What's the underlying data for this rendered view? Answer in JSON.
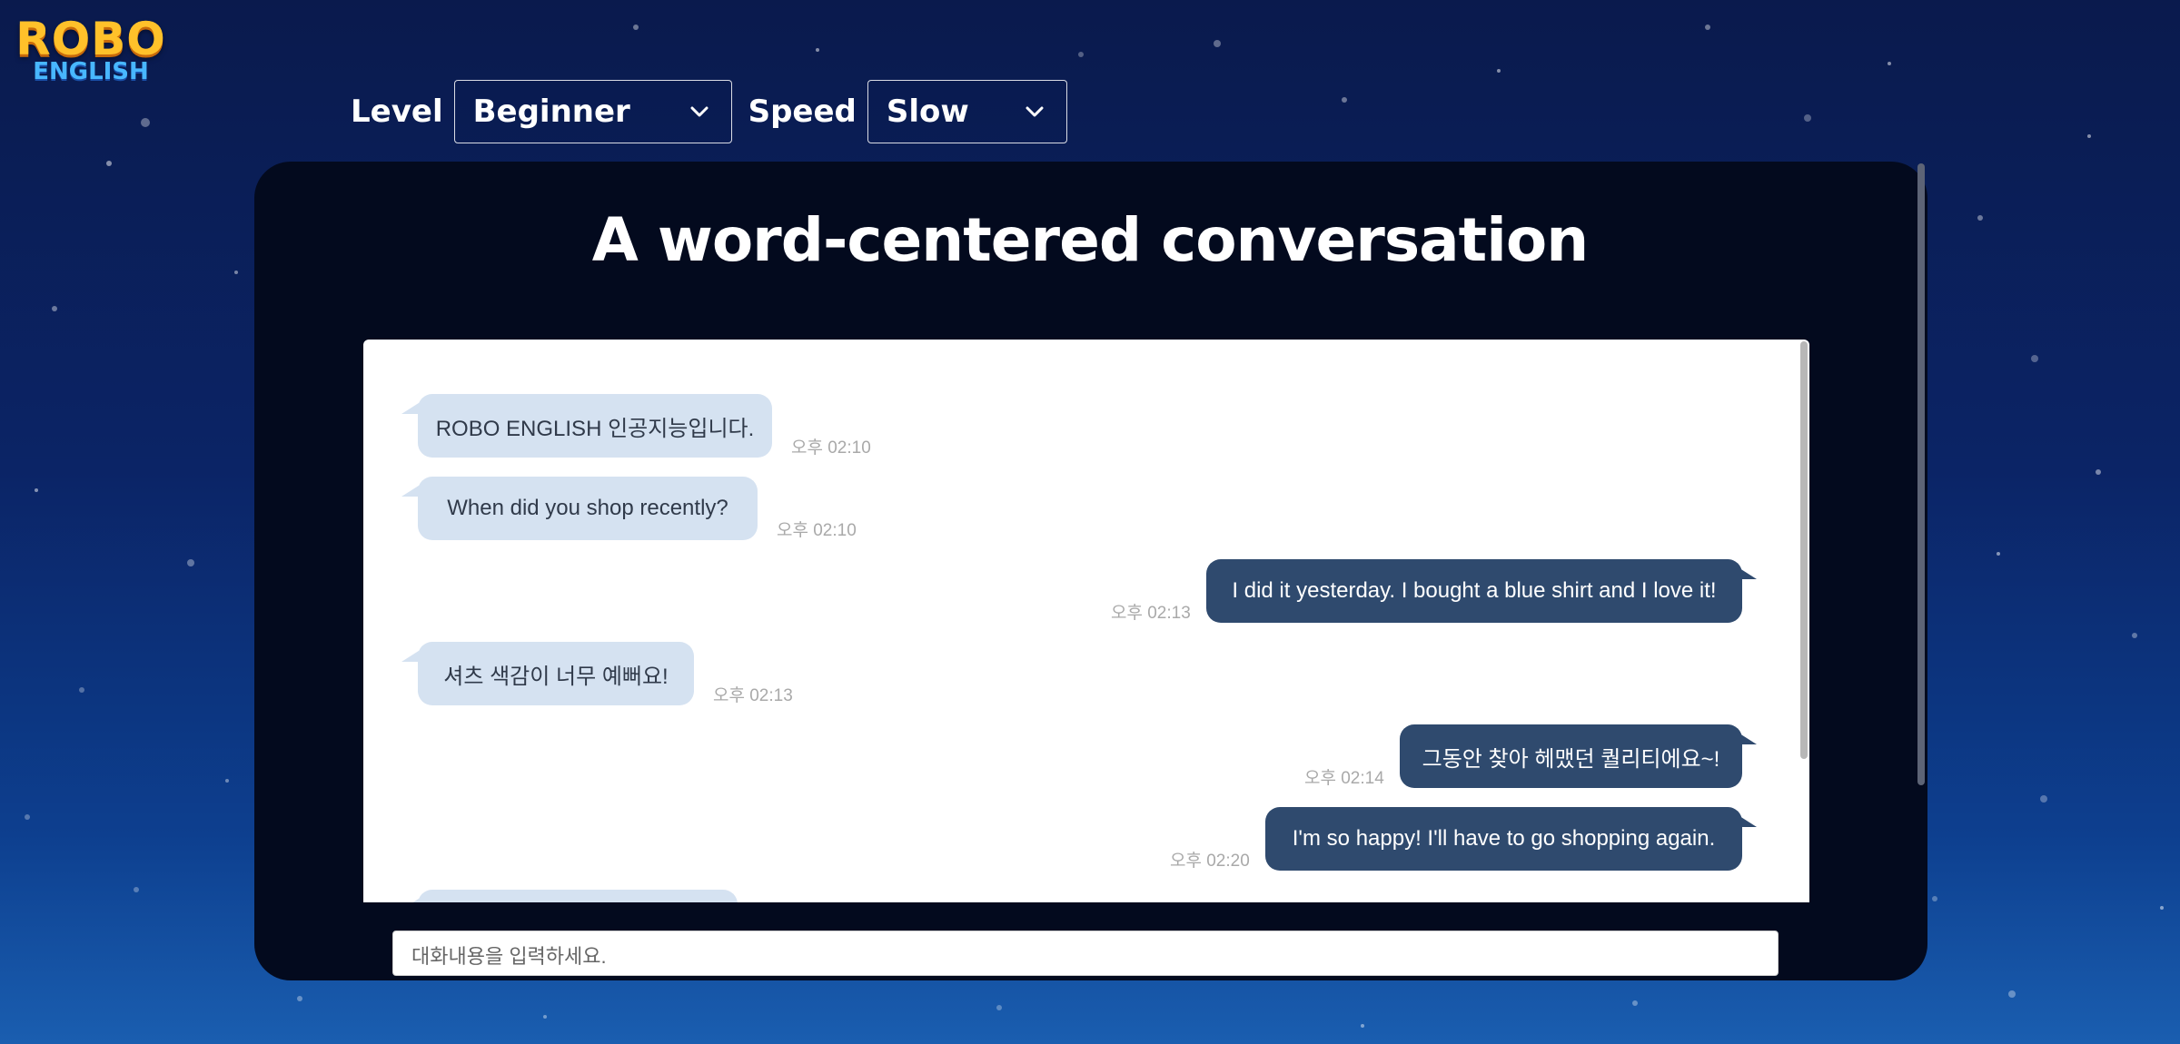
{
  "logo": {
    "line1": "ROBO",
    "line2": "ENGLISH"
  },
  "controls": {
    "level_label": "Level",
    "level_value": "Beginner",
    "speed_label": "Speed",
    "speed_value": "Slow"
  },
  "title": "A word-centered conversation",
  "messages": [
    {
      "sender": "bot",
      "text": "ROBO ENGLISH 인공지능입니다.",
      "time": "오후 02:10"
    },
    {
      "sender": "bot",
      "text": "When did you shop recently?",
      "time": "오후 02:10"
    },
    {
      "sender": "user",
      "text": "I did it yesterday. I bought a blue shirt and I love it!",
      "time": "오후 02:13"
    },
    {
      "sender": "bot",
      "text": "셔츠 색감이 너무 예뻐요!",
      "time": "오후 02:13"
    },
    {
      "sender": "user",
      "text": "그동안 찾아 헤맸던 퀄리티에요~!",
      "time": "오후 02:14"
    },
    {
      "sender": "user",
      "text": "I'm so happy! I'll have to go shopping again.",
      "time": "오후 02:20"
    }
  ],
  "input": {
    "placeholder": "대화내용을 입력하세요."
  },
  "colors": {
    "bot_bubble": "#d5e2f1",
    "user_bubble": "#2f4a6e",
    "logo_yellow": "#ffc12a",
    "logo_blue": "#48b7ff"
  }
}
